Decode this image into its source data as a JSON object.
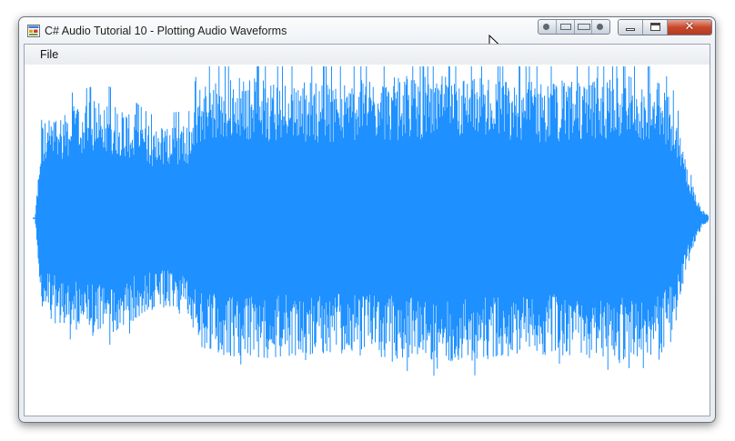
{
  "window": {
    "title": "C# Audio Tutorial 10 - Plotting Audio Waveforms",
    "icon": "form-app-icon",
    "caption_buttons": {
      "minimize_icon": "minimize-icon",
      "maximize_icon": "maximize-icon",
      "close_symbol": "✕"
    },
    "extra_title_buttons": [
      "record-icon",
      "pin-icon",
      "bar-icon",
      "record-icon"
    ]
  },
  "menu": {
    "items": [
      {
        "label": "File"
      }
    ]
  },
  "waveform": {
    "color": "#1e90ff",
    "baseline_color": "#1e90ff",
    "envelope": [
      [
        0.0,
        0.04
      ],
      [
        0.01,
        0.62
      ],
      [
        0.05,
        0.72
      ],
      [
        0.1,
        0.78
      ],
      [
        0.14,
        0.7
      ],
      [
        0.17,
        0.6
      ],
      [
        0.23,
        0.62
      ],
      [
        0.24,
        0.86
      ],
      [
        0.3,
        0.92
      ],
      [
        0.36,
        0.9
      ],
      [
        0.45,
        0.88
      ],
      [
        0.55,
        0.92
      ],
      [
        0.65,
        0.93
      ],
      [
        0.72,
        0.88
      ],
      [
        0.8,
        0.9
      ],
      [
        0.88,
        0.92
      ],
      [
        0.93,
        0.88
      ],
      [
        0.95,
        0.72
      ],
      [
        0.97,
        0.3
      ],
      [
        0.99,
        0.05
      ],
      [
        1.0,
        0.02
      ]
    ]
  }
}
